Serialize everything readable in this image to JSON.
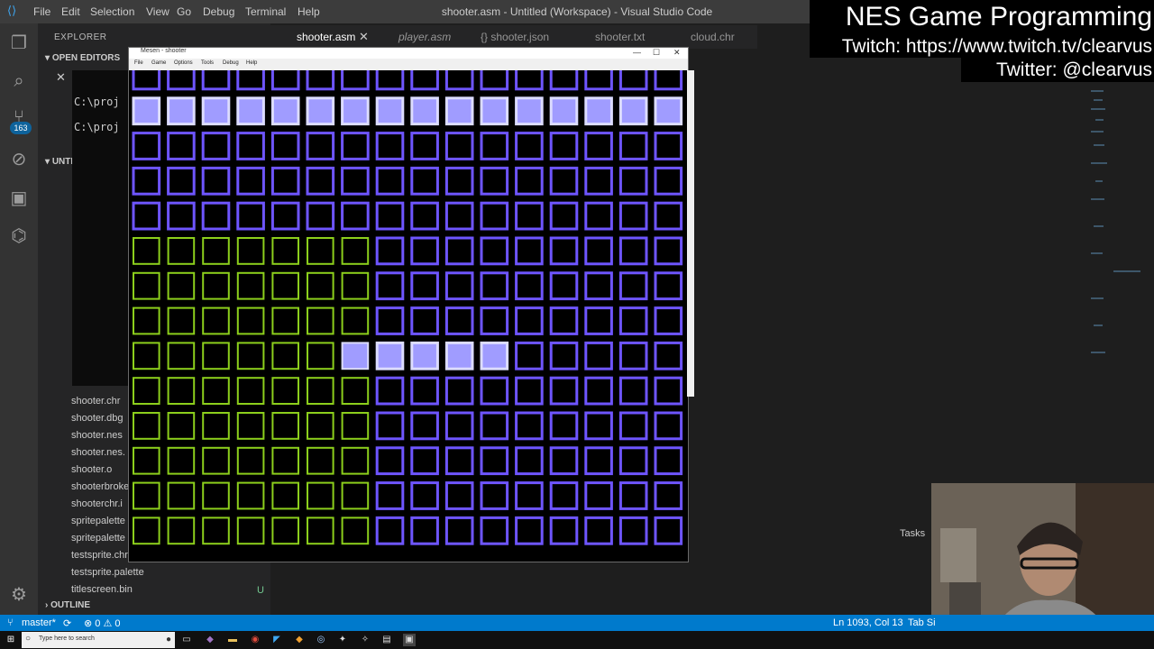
{
  "titlebar": {
    "menus": [
      "File",
      "Edit",
      "Selection",
      "View",
      "Go",
      "Debug",
      "Terminal",
      "Help"
    ],
    "window_title": "shooter.asm - Untitled (Workspace) - Visual Studio Code"
  },
  "activity_bar": {
    "badge_count": "163",
    "icons": [
      "files-icon",
      "search-icon",
      "source-control-icon",
      "debug-icon",
      "extensions-icon",
      "remote-icon",
      "settings-gear-icon"
    ]
  },
  "sidebar": {
    "title": "EXPLORER",
    "open_editors": "OPEN EDITORS",
    "workspace": "UNTI",
    "files": [
      "shooter.chr",
      "shooter.dbg",
      "shooter.nes",
      "shooter.nes.",
      "shooter.o",
      "shooterbroke",
      "shooterchr.i",
      "spritepalette",
      "spritepalette",
      "testsprite.chr",
      "testsprite.palette",
      "titlescreen.bin"
    ],
    "untracked_marker": "U",
    "outline": "OUTLINE"
  },
  "terminal": {
    "lines": [
      "C:\\proj",
      "C:\\proj"
    ]
  },
  "tabs": [
    {
      "label": "shooter.asm",
      "active": true
    },
    {
      "label": "player.asm",
      "active": false
    },
    {
      "label": "{} shooter.json",
      "active": false
    },
    {
      "label": "shooter.txt",
      "active": false
    },
    {
      "label": "cloud.chr",
      "active": false
    }
  ],
  "emulator": {
    "title": "Mesen - shooter",
    "menus": [
      "File",
      "Game",
      "Options",
      "Tools",
      "Debug",
      "Help"
    ],
    "controls": [
      "—",
      "☐",
      "✕"
    ]
  },
  "overlay": {
    "title": "NES Game Programming",
    "twitch": "Twitch: https://www.twitch.tv/clearvus",
    "twitter": "Twitter: @clearvus"
  },
  "panel": {
    "tasks_label": "Tasks"
  },
  "statusbar": {
    "branch": "master*",
    "problems": "⊗ 0 ⚠ 0",
    "position": "Ln 1093, Col 13",
    "tab_size": "Tab Si"
  },
  "taskbar": {
    "search_placeholder": "Type here to search"
  },
  "colors": {
    "statusbar": "#007acc",
    "tile_blue": "#6e55ff",
    "tile_green": "#8ccf1c",
    "tile_highlight": "#a09cff"
  }
}
